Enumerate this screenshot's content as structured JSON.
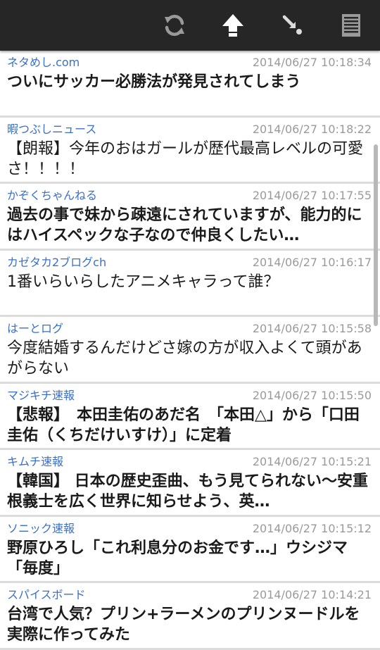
{
  "toolbar": {
    "icons": [
      "refresh-icon",
      "arrow-up-icon",
      "arrow-down-right-icon",
      "list-icon"
    ]
  },
  "items": [
    {
      "source": "ネタめし.com",
      "time": "2014/06/27 10:18:34",
      "title": "ついにサッカー必勝法が発見されてしまう",
      "bold": true
    },
    {
      "source": "暇つぶしニュース",
      "time": "2014/06/27 10:18:22",
      "title": "【朗報】今年のおはガールが歴代最高レベルの可愛さ！！！！",
      "bold": false
    },
    {
      "source": "かぞくちゃんねる",
      "time": "2014/06/27 10:17:55",
      "title": "過去の事で妹から疎遠にされていますが、能力的にはハイスペックな子なので仲良くしたい…",
      "bold": true
    },
    {
      "source": "カゼタカ2ブログch",
      "time": "2014/06/27 10:16:17",
      "title": "1番いらいらしたアニメキャラって誰？",
      "bold": false
    },
    {
      "source": "はーとログ",
      "time": "2014/06/27 10:15:58",
      "title": "今度結婚するんだけどさ嫁の方が収入よくて頭があがらない",
      "bold": false
    },
    {
      "source": "マジキチ速報",
      "time": "2014/06/27 10:15:50",
      "title": "【悲報】　本田圭佑のあだ名　「本田△」から「口田圭佑（くちだけいすけ）」に定着",
      "bold": true
    },
    {
      "source": "キムチ速報",
      "time": "2014/06/27 10:15:21",
      "title": "【韓国】 日本の歴史歪曲、もう見てられない～安重根義士を広く世界に知らせよう、英…",
      "bold": true
    },
    {
      "source": "ソニック速報",
      "time": "2014/06/27 10:15:12",
      "title": "野原ひろし「これ利息分のお金です…」ウシジマ「毎度」",
      "bold": true
    },
    {
      "source": "スパイスボード",
      "time": "2014/06/27 10:14:21",
      "title": "台湾で人気？プリン+ラーメンのプリンヌードルを実際に作ってみた",
      "bold": true
    }
  ]
}
